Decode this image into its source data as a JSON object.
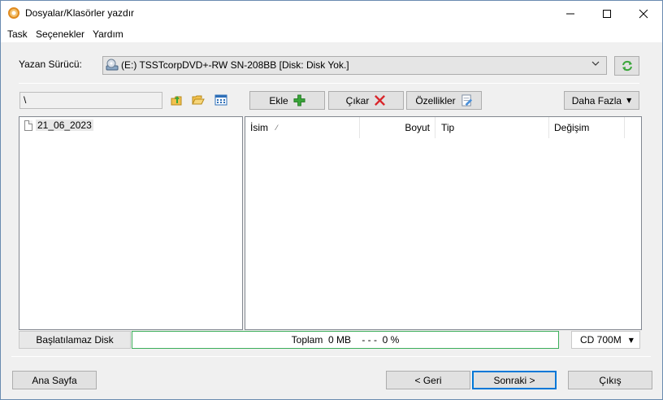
{
  "window": {
    "title": "Dosyalar/Klasörler yazdır",
    "minimize": "—",
    "maximize": "☐",
    "close": "✕"
  },
  "menu": [
    "Task",
    "Seçenekler",
    "Yardım"
  ],
  "drive": {
    "label": "Yazan Sürücü:",
    "selected": "(E:) TSSTcorpDVD+-RW SN-208BB [Disk: Disk Yok.]",
    "arrow": "⌵",
    "refresh_icon": "refresh-icon"
  },
  "toolbar": {
    "path": "\\",
    "add_label": "Ekle",
    "remove_label": "Çıkar",
    "properties_label": "Özellikler",
    "more_label": "Daha Fazla",
    "more_arrow": "▼"
  },
  "tree": {
    "items": [
      "21_06_2023"
    ]
  },
  "list": {
    "columns": [
      "İsim",
      "Boyut",
      "Tip",
      "Değişim"
    ],
    "sort_indicator": "⁄"
  },
  "status": {
    "disk_state": "Başlatılamaz Disk",
    "total": "Toplam  0 MB    - - -  0 %",
    "media": "CD 700M",
    "media_arrow": "▼"
  },
  "footer": {
    "home_label": "Ana Sayfa",
    "back_label": "< Geri",
    "next_label": "Sonraki >",
    "exit_label": "Çıkış"
  },
  "colors": {
    "accent": "#0078d7",
    "add_green": "#3aa63a",
    "remove_red": "#d9262b",
    "progress_green": "#3cae5a"
  }
}
